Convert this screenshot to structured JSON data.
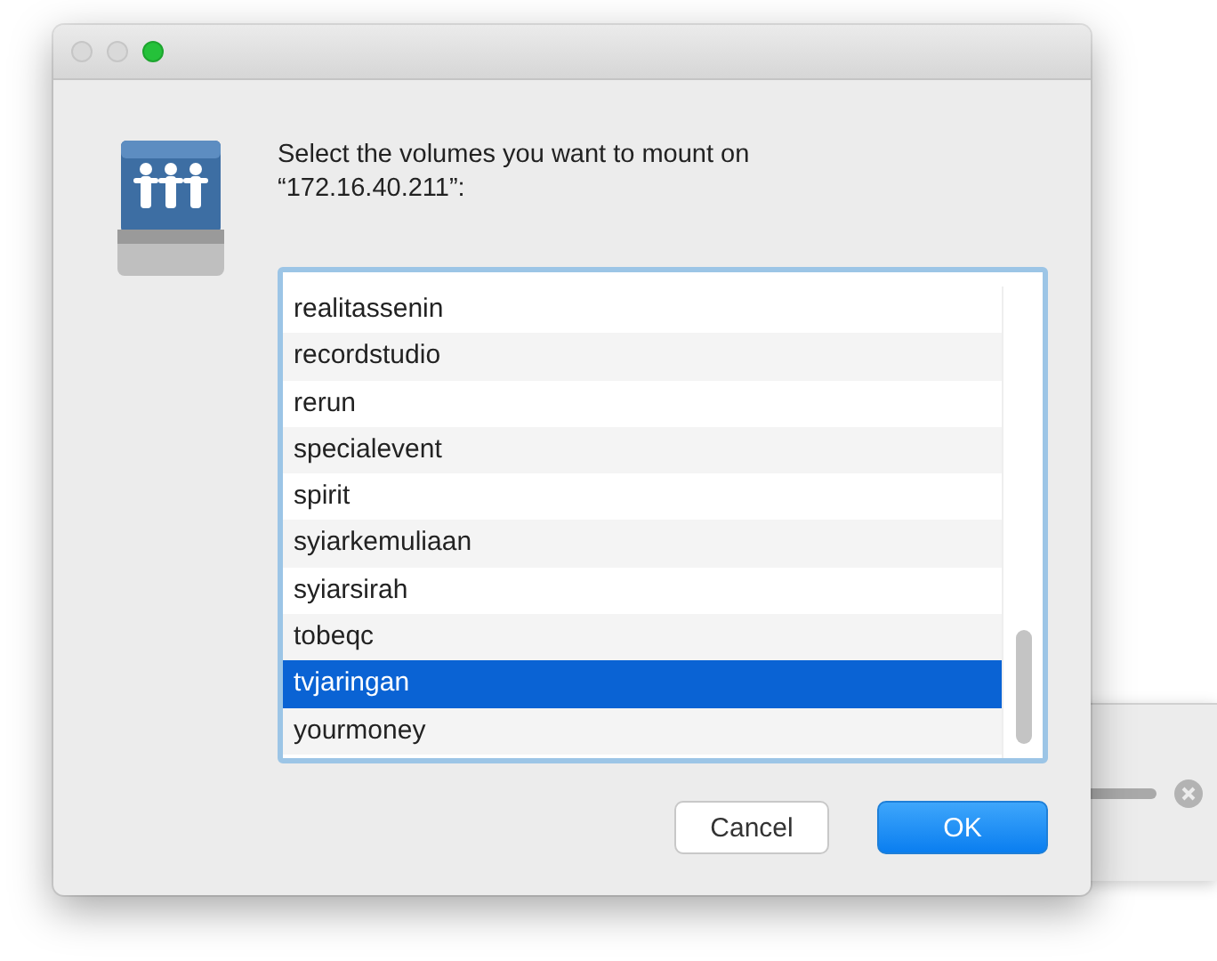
{
  "dialog": {
    "traffic_lights": [
      {
        "enabled": false
      },
      {
        "enabled": false
      },
      {
        "enabled": true
      }
    ],
    "prompt": "Select the volumes you want to mount on “172.16.40.211”:",
    "volumes": [
      {
        "name": "realitassenin",
        "selected": false
      },
      {
        "name": "recordstudio",
        "selected": false
      },
      {
        "name": "rerun",
        "selected": false
      },
      {
        "name": "specialevent",
        "selected": false
      },
      {
        "name": "spirit",
        "selected": false
      },
      {
        "name": "syiarkemuliaan",
        "selected": false
      },
      {
        "name": "syiarsirah",
        "selected": false
      },
      {
        "name": "tobeqc",
        "selected": false
      },
      {
        "name": "tvjaringan",
        "selected": true
      },
      {
        "name": "yourmoney",
        "selected": false
      }
    ],
    "buttons": [
      {
        "label": "Cancel",
        "kind": "secondary"
      },
      {
        "label": "OK",
        "kind": "default"
      }
    ]
  },
  "background_window": {
    "progress": {
      "level": 1
    }
  }
}
